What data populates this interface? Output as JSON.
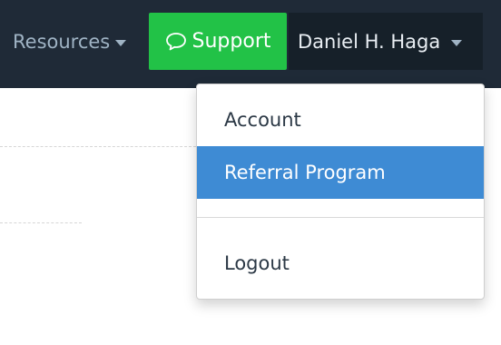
{
  "navbar": {
    "resources_label": "Resources",
    "support_label": "Support",
    "user_name": "Daniel H. Haga"
  },
  "user_menu": {
    "items": [
      {
        "label": "Account"
      },
      {
        "label": "Referral Program",
        "highlighted": true
      },
      {
        "label": "Logout"
      }
    ]
  },
  "colors": {
    "navbar_bg": "#1f2a37",
    "support_bg": "#22c247",
    "highlight_bg": "#3e8bd4"
  },
  "icons": {
    "support": "speech-bubble-icon",
    "dropdown": "caret-down-icon"
  }
}
